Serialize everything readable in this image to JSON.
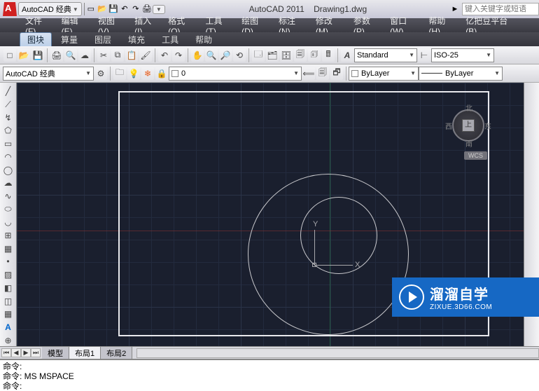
{
  "titlebar": {
    "workspace": "AutoCAD 经典",
    "app": "AutoCAD 2011",
    "doc": "Drawing1.dwg",
    "search_placeholder": "键入关键字或短语"
  },
  "menus": [
    "文件(F)",
    "编辑(E)",
    "视图(V)",
    "插入(I)",
    "格式(O)",
    "工具(T)",
    "绘图(D)",
    "标注(N)",
    "修改(M)",
    "参数(P)",
    "窗口(W)",
    "帮助(H)",
    "亿把豆平台(B)"
  ],
  "submenu": {
    "active": "图块",
    "items": [
      "图块",
      "算量",
      "图层",
      "填充",
      "工具",
      "帮助"
    ]
  },
  "toolbar2": {
    "workspace": "AutoCAD 经典",
    "layer": "0",
    "style": "Standard",
    "dimstyle": "ISO-25"
  },
  "toolbar3": {
    "bylayer1": "ByLayer",
    "bylayer2": "ByLayer"
  },
  "compass": {
    "n": "北",
    "s": "南",
    "e": "东",
    "w": "西",
    "cube": "上",
    "wcs": "WCS"
  },
  "ucs": {
    "x": "X",
    "y": "Y"
  },
  "layout_tabs": [
    "模型",
    "布局1",
    "布局2"
  ],
  "cmd": {
    "line1": "命令:",
    "line2": "命令: MS MSPACE",
    "prompt": "命令:"
  },
  "watermark": {
    "big": "溜溜自学",
    "small": "ZIXUE.3D66.COM"
  }
}
